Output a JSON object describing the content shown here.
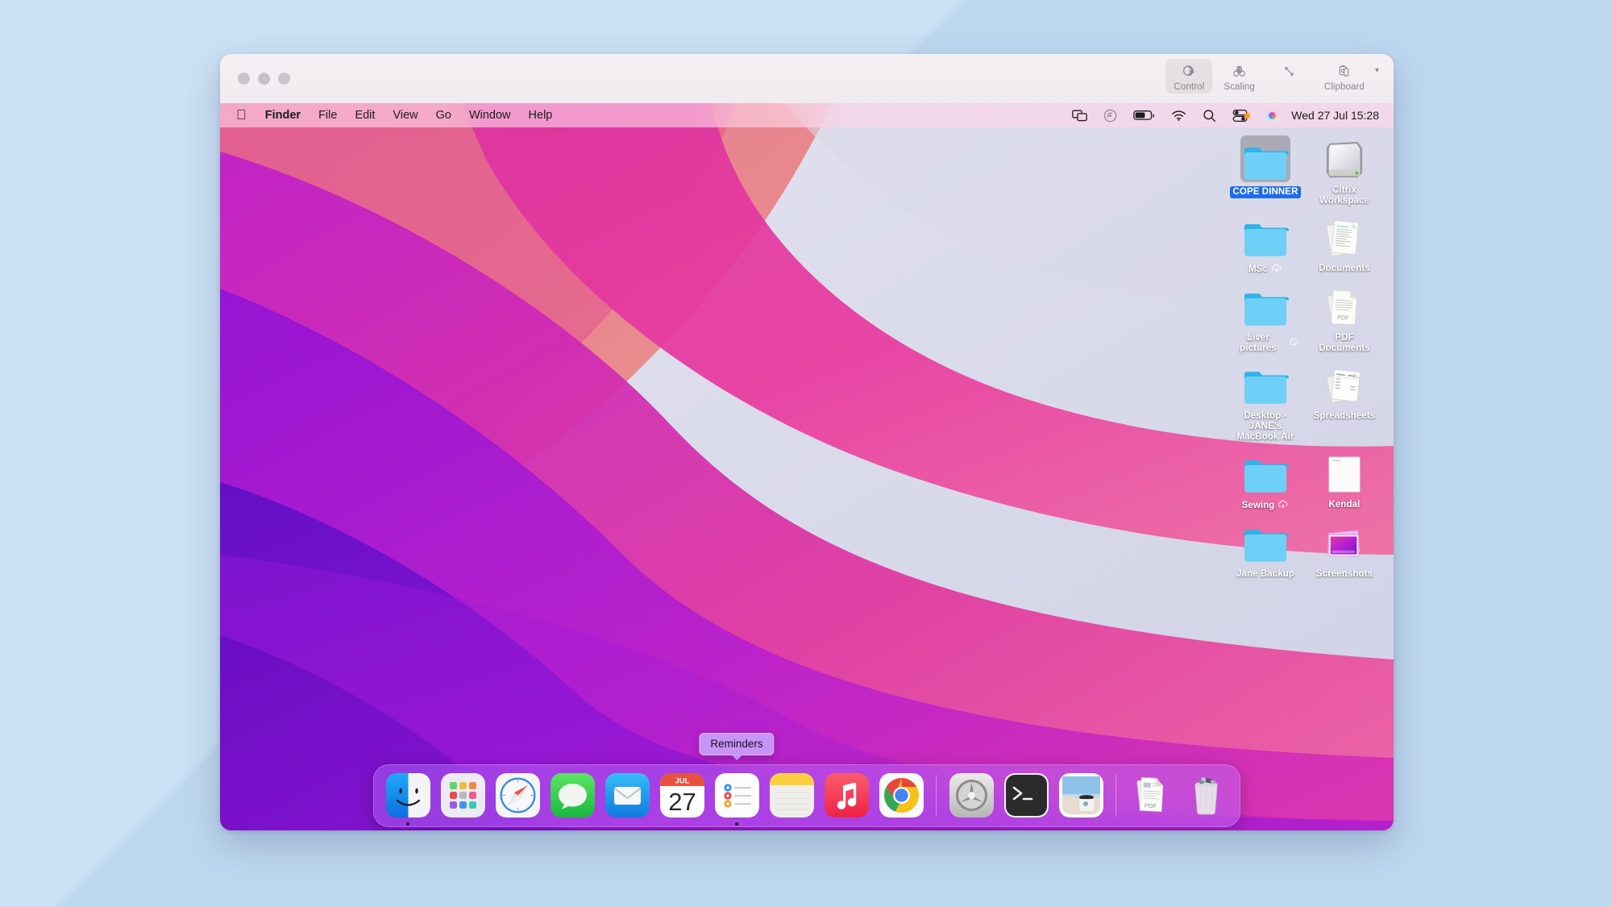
{
  "viewer": {
    "tools": [
      {
        "label": "Control",
        "icon": "cursor-control-icon",
        "active": true
      },
      {
        "label": "Scaling",
        "icon": "binoculars-icon",
        "active": false
      },
      {
        "label": "",
        "icon": "resize-diagonal-icon",
        "active": false
      },
      {
        "label": "Clipboard",
        "icon": "clipboard-icon",
        "active": false
      }
    ],
    "scaling_label": "Scaling",
    "window_controls": [
      "close",
      "minimize",
      "zoom"
    ]
  },
  "menubar": {
    "apple_logo": "apple-logo-icon",
    "items": [
      {
        "label": "Finder",
        "bold": true
      },
      {
        "label": "File",
        "bold": false
      },
      {
        "label": "Edit",
        "bold": false
      },
      {
        "label": "View",
        "bold": false
      },
      {
        "label": "Go",
        "bold": false
      },
      {
        "label": "Window",
        "bold": false
      },
      {
        "label": "Help",
        "bold": false
      }
    ],
    "status_icons": [
      "screen-mirroring-icon",
      "airdrop-icon",
      "battery-icon",
      "wifi-icon",
      "spotlight-search-icon",
      "control-center-icon",
      "siri-icon"
    ],
    "clock": "Wed 27 Jul  15:28"
  },
  "desktop": {
    "icons": [
      {
        "name": "COPE DINNER",
        "type": "folder",
        "selected": true,
        "cloud": false
      },
      {
        "name": "Citrix Workspace",
        "type": "drive",
        "selected": false,
        "cloud": false
      },
      {
        "name": "MSc",
        "type": "folder",
        "selected": false,
        "cloud": true
      },
      {
        "name": "Documents",
        "type": "documents-stack",
        "selected": false,
        "cloud": false
      },
      {
        "name": "Liver pictures",
        "type": "folder",
        "selected": false,
        "cloud": true
      },
      {
        "name": "PDF Documents",
        "type": "pdf-stack",
        "selected": false,
        "cloud": false
      },
      {
        "name": "Desktop - JANE's MacBook Air",
        "type": "folder",
        "selected": false,
        "cloud": false
      },
      {
        "name": "Spreadsheets",
        "type": "spreadsheet-stack",
        "selected": false,
        "cloud": false
      },
      {
        "name": "Sewing",
        "type": "folder",
        "selected": false,
        "cloud": true
      },
      {
        "name": "Kendal",
        "type": "document",
        "selected": false,
        "cloud": false
      },
      {
        "name": "Jane Backup",
        "type": "folder",
        "selected": false,
        "cloud": false
      },
      {
        "name": "Screenshots",
        "type": "screenshot-stack",
        "selected": false,
        "cloud": false
      }
    ]
  },
  "dock": {
    "tooltip": "Reminders",
    "calendar_month": "JUL",
    "calendar_day": "27",
    "pdf_label": "PDF",
    "apps": [
      {
        "name": "Finder",
        "icon": "finder-icon",
        "running": true
      },
      {
        "name": "Launchpad",
        "icon": "launchpad-icon",
        "running": false
      },
      {
        "name": "Safari",
        "icon": "safari-icon",
        "running": false
      },
      {
        "name": "Messages",
        "icon": "messages-icon",
        "running": false
      },
      {
        "name": "Mail",
        "icon": "mail-icon",
        "running": false
      },
      {
        "name": "Calendar",
        "icon": "calendar-icon",
        "running": false
      },
      {
        "name": "Reminders",
        "icon": "reminders-icon",
        "running": true
      },
      {
        "name": "Notes",
        "icon": "notes-icon",
        "running": false
      },
      {
        "name": "Music",
        "icon": "music-icon",
        "running": false
      },
      {
        "name": "Google Chrome",
        "icon": "chrome-icon",
        "running": false
      },
      {
        "name": "System Preferences",
        "icon": "system-preferences-icon",
        "running": false
      },
      {
        "name": "Terminal",
        "icon": "terminal-icon",
        "running": false
      },
      {
        "name": "Preview",
        "icon": "preview-icon",
        "running": false
      }
    ],
    "stacks": [
      {
        "name": "PDF Documents",
        "icon": "pdf-stack-icon"
      },
      {
        "name": "Trash",
        "icon": "trash-icon"
      }
    ]
  },
  "colors": {
    "backdrop": "#c6ddf2",
    "selection_blue": "#1c6cea",
    "dock_tint": "#ba78ff",
    "menubar_tint": "#ffd6ea"
  }
}
